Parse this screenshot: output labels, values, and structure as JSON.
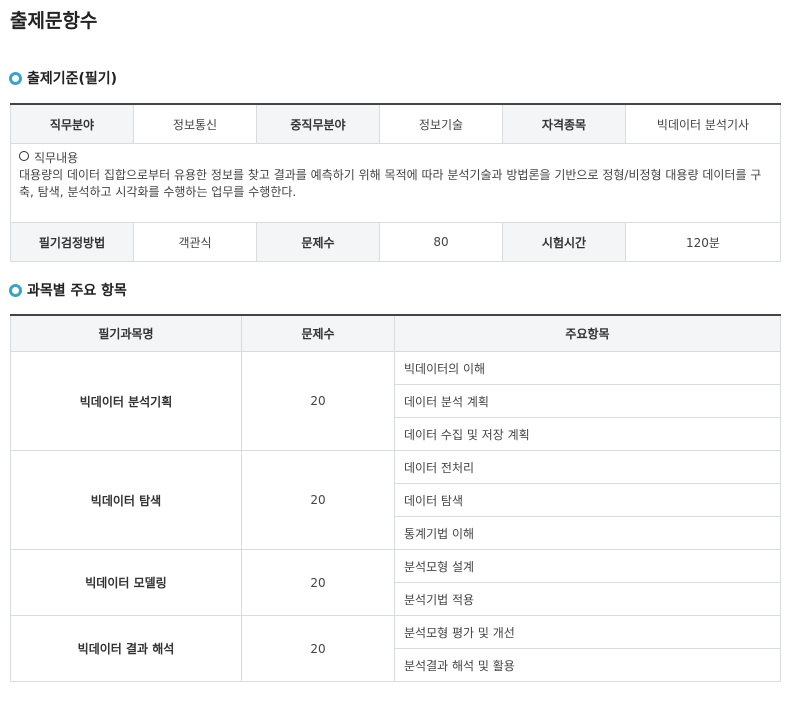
{
  "page_title": "출제문항수",
  "section1": {
    "heading": "출제기준(필기)",
    "row1": [
      {
        "label": "직무분야",
        "value": "정보통신"
      },
      {
        "label": "중직무분야",
        "value": "정보기술"
      },
      {
        "label": "자격종목",
        "value": "빅데이터 분석기사"
      }
    ],
    "duty_title": "직무내용",
    "duty_text": "대용량의 데이터 집합으로부터 유용한 정보를 찾고 결과를 예측하기 위해 목적에 따라 분석기술과 방법론을 기반으로 정형/비정형 대용량 데이터를 구축, 탐색, 분석하고 시각화를 수행하는 업무를 수행한다.",
    "row3": [
      {
        "label": "필기검정방법",
        "value": "객관식"
      },
      {
        "label": "문제수",
        "value": "80"
      },
      {
        "label": "시험시간",
        "value": "120분"
      }
    ]
  },
  "section2": {
    "heading": "과목별 주요 항목",
    "headers": [
      "필기과목명",
      "문제수",
      "주요항목"
    ],
    "subjects": [
      {
        "name": "빅데이터 분석기획",
        "count": "20",
        "items": [
          "빅데이터의 이해",
          "데이터 분석 계획",
          "데이터 수집 및 저장 계획"
        ]
      },
      {
        "name": "빅데이터 탐색",
        "count": "20",
        "items": [
          "데이터 전처리",
          "데이터 탐색",
          "통계기법 이해"
        ]
      },
      {
        "name": "빅데이터 모델링",
        "count": "20",
        "items": [
          "분석모형 설계",
          "분석기법 적용"
        ]
      },
      {
        "name": "빅데이터 결과 해석",
        "count": "20",
        "items": [
          "분석모형 평가 및 개선",
          "분석결과 해석 및 활용"
        ]
      }
    ]
  }
}
